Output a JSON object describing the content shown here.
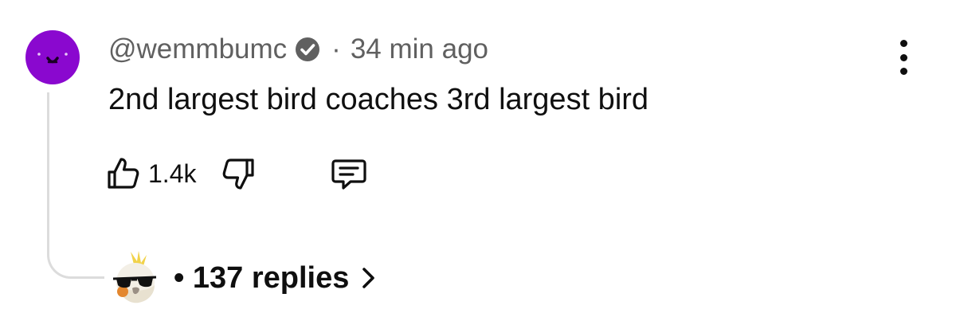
{
  "comment": {
    "author": "@wemmbumc",
    "separator": "·",
    "time_ago": "34 min ago",
    "text": "2nd largest bird coaches 3rd largest bird",
    "like_count": "1.4k",
    "avatar_color": "#8a08cf"
  },
  "replies": {
    "separator": "•",
    "count_label": "137 replies"
  },
  "icons": {
    "verified": "verified-check-icon",
    "more": "more-vertical-icon",
    "like": "thumbs-up-icon",
    "dislike": "thumbs-down-icon",
    "reply": "comment-icon",
    "chevron": "chevron-right-icon"
  },
  "colors": {
    "text_primary": "#0f0f0f",
    "text_secondary": "#606060",
    "thread_line": "#dcdcdc"
  }
}
